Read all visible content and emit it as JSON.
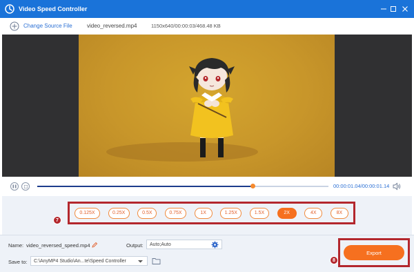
{
  "window": {
    "title": "Video Speed Controller"
  },
  "toolbar": {
    "change_source_label": "Change Source File",
    "file_name": "video_reversed.mp4",
    "file_info": "1150x640/00:00:03/468.48 KB"
  },
  "player": {
    "time": "00:00:01.04/00:00:01.14",
    "progress": 0.74
  },
  "speeds": {
    "options": [
      "0.125X",
      "0.25X",
      "0.5X",
      "0.75X",
      "1X",
      "1.25X",
      "1.5X",
      "2X",
      "4X",
      "8X"
    ],
    "selected": "2X",
    "step_badge": "7"
  },
  "output": {
    "name_label": "Name:",
    "name_value": "video_reversed_speed.mp4",
    "output_label": "Output:",
    "output_value": "Auto;Auto",
    "save_label": "Save to:",
    "save_path": "C:\\AnyMP4 Studio\\An...te\\Speed Controller"
  },
  "export": {
    "label": "Export",
    "step_badge": "8"
  },
  "colors": {
    "titlebar": "#1a73d9",
    "accent": "#f6701f",
    "highlight_frame": "#b3272d",
    "link": "#2a6fd4"
  }
}
